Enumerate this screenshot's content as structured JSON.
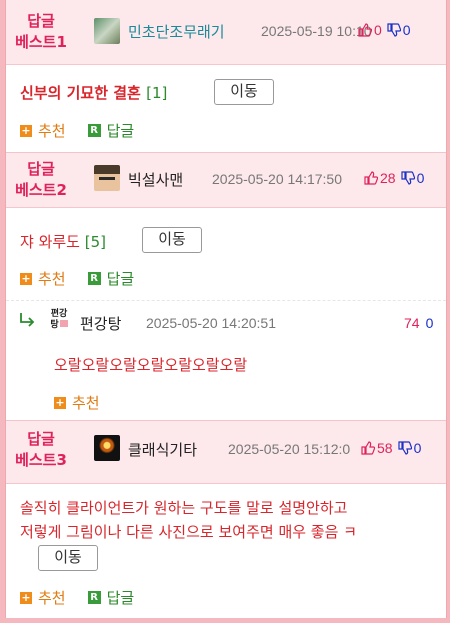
{
  "posts": [
    {
      "label_line1": "답글",
      "label_line2": "베스트1",
      "nickname": "민초단조무래기",
      "date": "2025-05-19 1",
      "date_overlap": "0:10",
      "up": "0",
      "down": "0",
      "title": "신부의 기묘한 결혼",
      "count": "[1]",
      "move_label": "이동",
      "recommend_label": "추천",
      "reply_label": "답글"
    },
    {
      "label_line1": "답글",
      "label_line2": "베스트2",
      "nickname": "빅설사맨",
      "date": "2025-05-20 14:17:50",
      "up": "28",
      "down": "0",
      "title": "쟈 와루도",
      "count": "[5]",
      "move_label": "이동",
      "recommend_label": "추천",
      "reply_label": "답글"
    },
    {
      "label_line1": "답글",
      "label_line2": "베스트3",
      "nickname": "클래식기타",
      "date": "2025-05-20 15:12:0",
      "up": "58",
      "down": "0",
      "title_line1": "솔직히 클라이언트가 원하는 구도를 말로 설명안하고",
      "title_line2": "저렇게 그림이나 다른 사진으로 보여주면 매우 좋음 ㅋ",
      "move_label": "이동",
      "recommend_label": "추천",
      "reply_label": "답글"
    }
  ],
  "reply": {
    "avatar_text_top": "편강",
    "avatar_text_bottom": "탕",
    "nickname": "편강탕",
    "date": "2025-05-20 14:20:51",
    "up": "74",
    "down": "0",
    "text": "오랄오랄오랄오랄오랄오랄오랄",
    "recommend_label": "추천"
  },
  "colors": {
    "accent_pink": "#e0225b",
    "title_red": "#d8262c",
    "recommend_orange": "#e07b12",
    "reply_green": "#2b8a2b",
    "down_blue": "#1a30c8"
  },
  "icons": {
    "thumb_up": "thumb-up-icon",
    "thumb_down": "thumb-down-icon",
    "reply_arrow": "reply-arrow-icon",
    "plus": "plus-icon",
    "reply_badge": "reply-badge-icon"
  }
}
